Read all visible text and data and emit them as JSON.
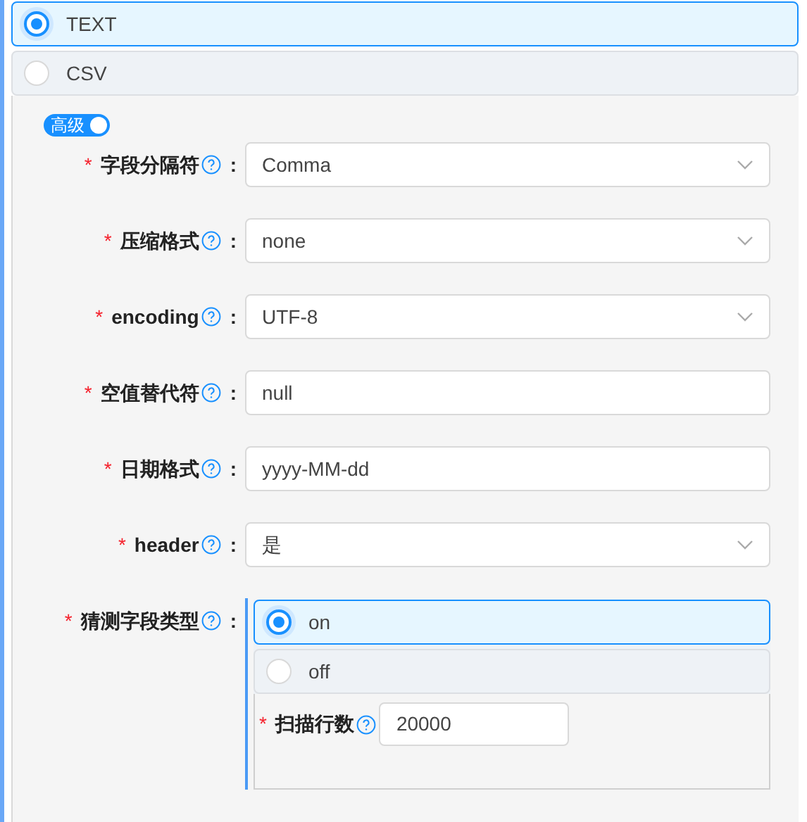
{
  "formats": [
    {
      "label": "TEXT",
      "selected": true
    },
    {
      "label": "CSV",
      "selected": false
    }
  ],
  "advanced": {
    "label": "高级",
    "on": true
  },
  "fields": [
    {
      "mark": "*",
      "label": "字段分隔符",
      "colon": ":",
      "kind": "select",
      "value": "Comma"
    },
    {
      "mark": "*",
      "label": "压缩格式",
      "colon": ":",
      "kind": "select",
      "value": "none"
    },
    {
      "mark": "*",
      "label": "encoding",
      "colon": ":",
      "kind": "select",
      "value": "UTF-8"
    },
    {
      "mark": "*",
      "label": "空值替代符",
      "colon": ":",
      "kind": "input",
      "value": "null"
    },
    {
      "mark": "*",
      "label": "日期格式",
      "colon": ":",
      "kind": "input",
      "value": "yyyy-MM-dd"
    },
    {
      "mark": "*",
      "label": "header",
      "colon": ":",
      "kind": "select",
      "value": "是"
    }
  ],
  "guess": {
    "mark": "*",
    "label": "猜测字段类型",
    "colon": ":",
    "options": [
      {
        "label": "on",
        "selected": true
      },
      {
        "label": "off",
        "selected": false
      }
    ],
    "scan": {
      "mark": "*",
      "label": "扫描行数",
      "value": "20000"
    }
  }
}
